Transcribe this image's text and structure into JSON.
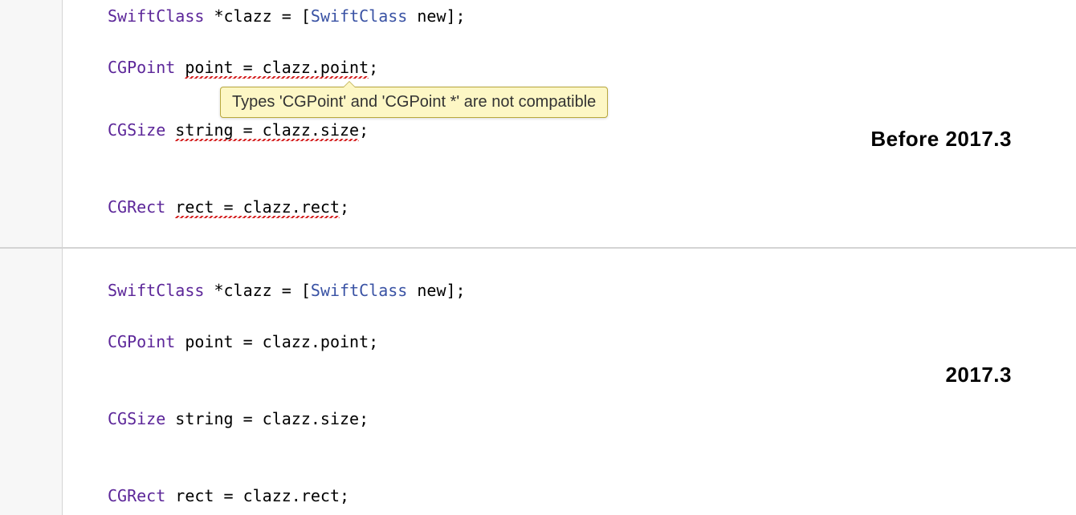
{
  "labels": {
    "before": "Before 2017.3",
    "after": "2017.3"
  },
  "tooltip": "Types 'CGPoint' and 'CGPoint *' are not compatible",
  "top": {
    "line1": {
      "t1": "SwiftClass",
      "op1": " *",
      "id1": "clazz",
      "op2": " = [",
      "cls": "SwiftClass",
      "rest": " new];"
    },
    "line2": {
      "t1": "CGPoint",
      "sp": " ",
      "err": "point = clazz.point",
      "semi": ";"
    },
    "line3": {
      "t1": "CGSize",
      "sp": " ",
      "err": "string = clazz.size",
      "semi": ";"
    },
    "line4": {
      "t1": "CGRect",
      "sp": " ",
      "err": "rect = clazz.rect",
      "semi": ";"
    }
  },
  "bottom": {
    "line1": {
      "t1": "SwiftClass",
      "op1": " *",
      "id1": "clazz",
      "op2": " = [",
      "cls": "SwiftClass",
      "rest": " new];"
    },
    "line2": {
      "t1": "CGPoint",
      "rest": " point = clazz.point;"
    },
    "line3": {
      "t1": "CGSize",
      "rest": " string = clazz.size;"
    },
    "line4": {
      "t1": "CGRect",
      "rest": " rect = clazz.rect;"
    }
  }
}
